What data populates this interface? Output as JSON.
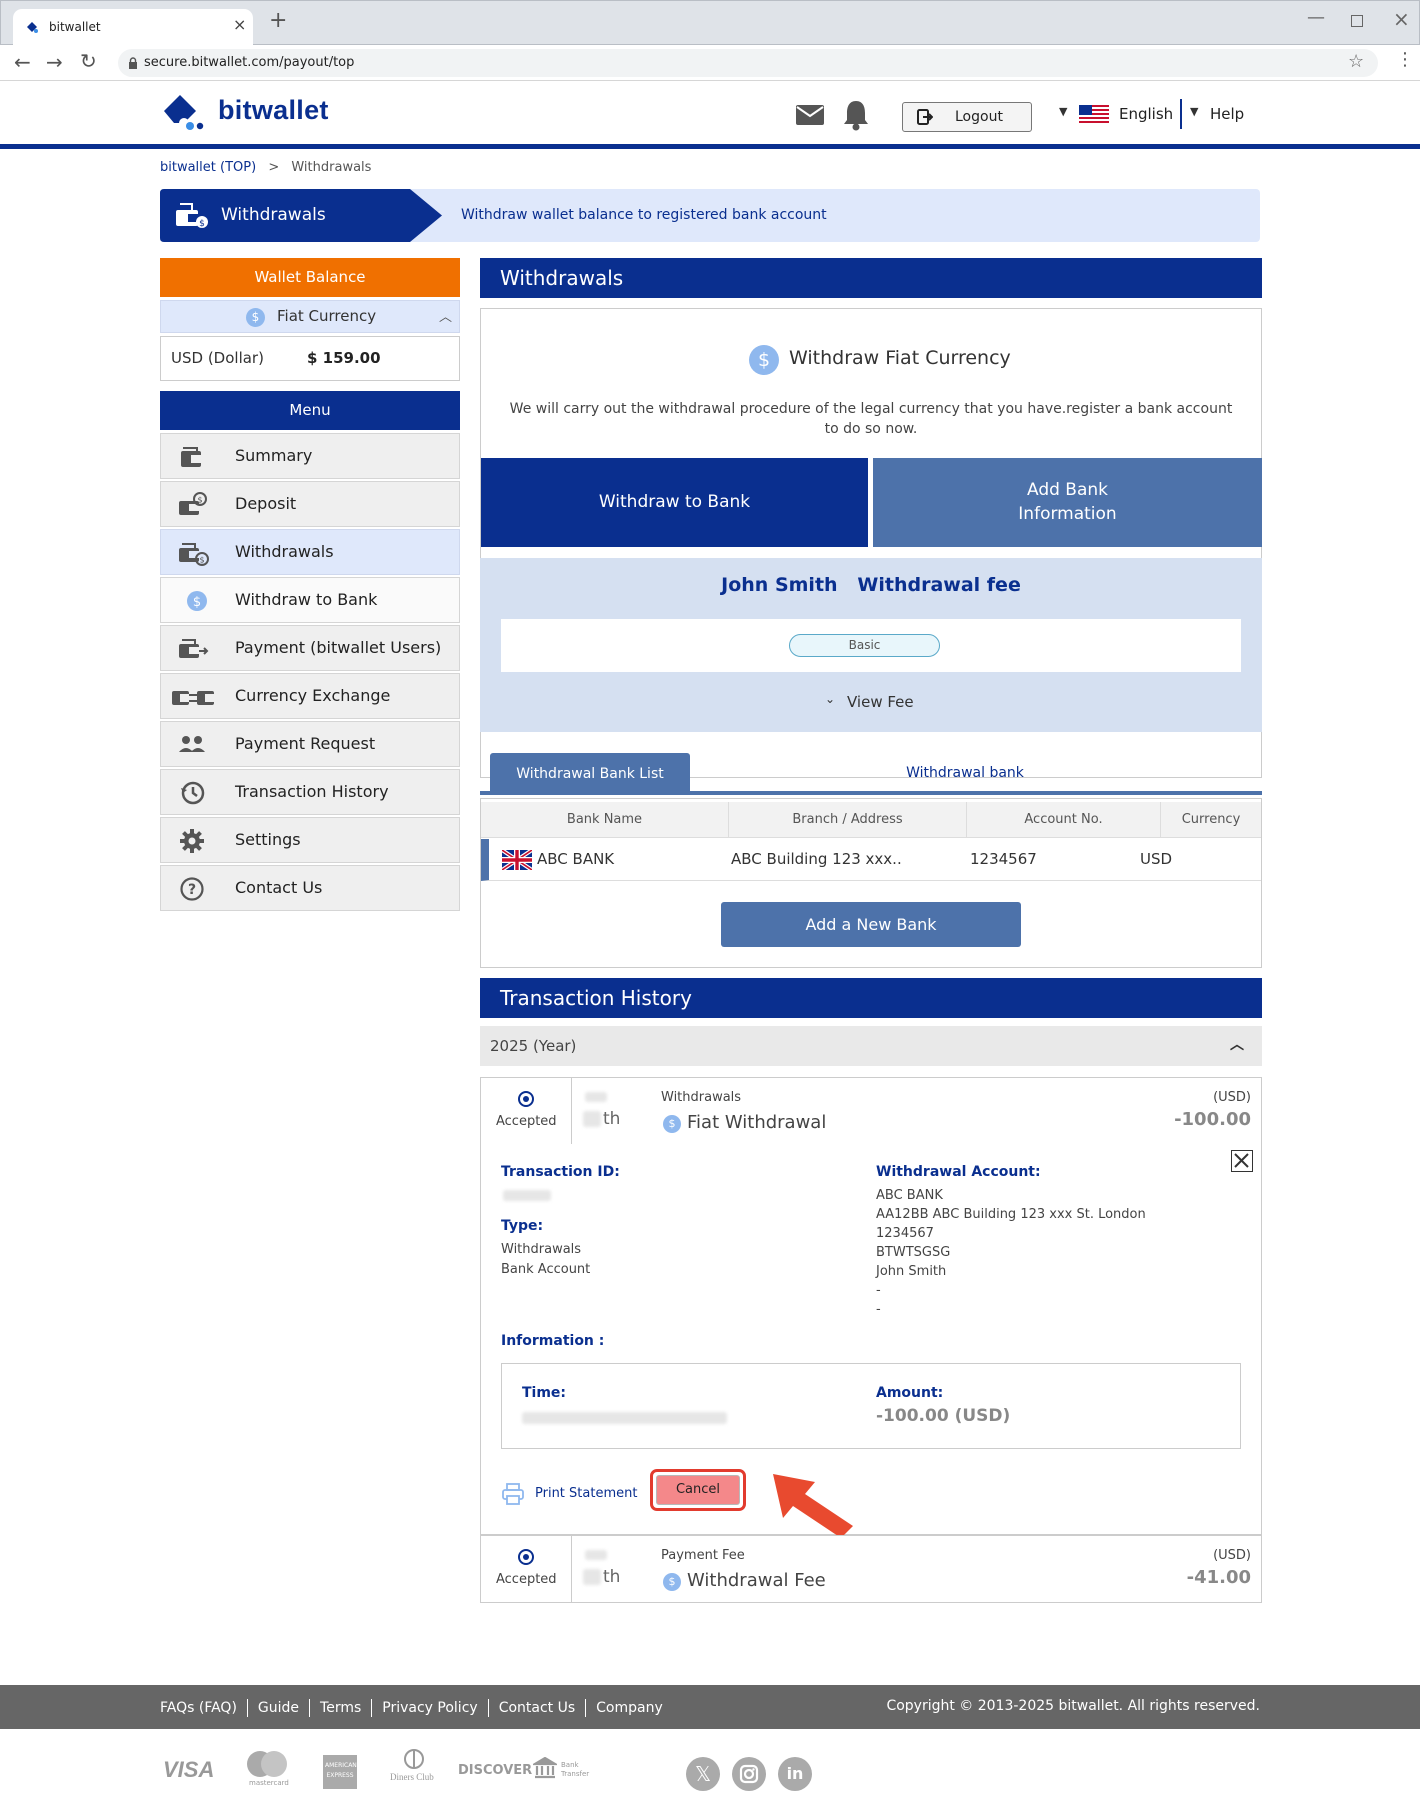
{
  "browser": {
    "tab_title": "bitwallet",
    "url": "secure.bitwallet.com/payout/top"
  },
  "header": {
    "logo_text": "bitwallet",
    "logout_label": "Logout",
    "language": "English",
    "help_label": "Help"
  },
  "breadcrumb": {
    "home": "bitwallet (TOP)",
    "separator": ">",
    "current": "Withdrawals"
  },
  "banner": {
    "title": "Withdrawals",
    "description": "Withdraw wallet balance to registered bank account"
  },
  "sidebar": {
    "wallet_balance_title": "Wallet Balance",
    "fiat_currency_label": "Fiat Currency",
    "balance_currency": "USD (Dollar)",
    "balance_amount": "$ 159.00",
    "menu_title": "Menu",
    "items": [
      {
        "label": "Summary",
        "icon": "wallet-icon"
      },
      {
        "label": "Deposit",
        "icon": "deposit-icon"
      },
      {
        "label": "Withdrawals",
        "icon": "withdraw-icon"
      },
      {
        "label": "Withdraw to Bank",
        "icon": "dollar-coin-icon"
      },
      {
        "label": "Payment (bitwallet Users)",
        "icon": "payment-icon"
      },
      {
        "label": "Currency Exchange",
        "icon": "exchange-icon"
      },
      {
        "label": "Payment Request",
        "icon": "users-icon"
      },
      {
        "label": "Transaction History",
        "icon": "history-icon"
      },
      {
        "label": "Settings",
        "icon": "gear-icon"
      },
      {
        "label": "Contact Us",
        "icon": "question-icon"
      }
    ]
  },
  "withdrawals": {
    "section_title": "Withdrawals",
    "fiat_title": "Withdraw Fiat Currency",
    "fiat_desc": "We will carry out the withdrawal procedure of the legal currency that you have.register a bank account to do so now.",
    "tab_withdraw": "Withdraw to Bank",
    "tab_add_bank_line1": "Add Bank",
    "tab_add_bank_line2": "Information",
    "fee_name": "John Smith",
    "fee_title": "Withdrawal fee",
    "fee_badge": "Basic",
    "view_fee": "View Fee"
  },
  "bank_list": {
    "tab_active": "Withdrawal Bank List",
    "tab_inactive": "Withdrawal bank",
    "columns": [
      "Bank Name",
      "Branch / Address",
      "Account No.",
      "Currency"
    ],
    "rows": [
      {
        "bank": "ABC BANK",
        "branch": "ABC Building 123 xxx..",
        "account": "1234567",
        "currency": "USD"
      }
    ],
    "add_button": "Add a New Bank"
  },
  "history": {
    "section_title": "Transaction History",
    "year_label": "2025 (Year)",
    "tx1": {
      "status": "Accepted",
      "day_suffix": "th",
      "category": "Withdrawals",
      "title": "Fiat Withdrawal",
      "currency": "(USD)",
      "amount": "-100.00"
    },
    "detail": {
      "txid_label": "Transaction ID:",
      "type_label": "Type:",
      "type_value1": "Withdrawals",
      "type_value2": "Bank Account",
      "account_label": "Withdrawal Account:",
      "account_lines": [
        "ABC BANK",
        "AA12BB ABC Building 123 xxx St. London",
        "1234567",
        "BTWTSGSG",
        "John Smith",
        "-",
        "-"
      ],
      "info_label": "Information :",
      "time_label": "Time:",
      "amount_label": "Amount:",
      "amount_value": "-100.00 (USD)",
      "print_label": "Print Statement",
      "cancel_label": "Cancel"
    },
    "tx2": {
      "status": "Accepted",
      "day_suffix": "th",
      "category": "Payment Fee",
      "title": "Withdrawal Fee",
      "currency": "(USD)",
      "amount": "-41.00"
    }
  },
  "footer": {
    "links": [
      "FAQs (FAQ)",
      "Guide",
      "Terms",
      "Privacy Policy",
      "Contact Us",
      "Company"
    ],
    "copyright": "Copyright © 2013-2025 bitwallet. All rights reserved.",
    "payment_logos": [
      "VISA",
      "mastercard",
      "AMERICAN EXPRESS",
      "Diners Club",
      "DISCOVER",
      "Bank Transfer"
    ],
    "social_icons": [
      "x-icon",
      "instagram-icon",
      "linkedin-icon"
    ]
  }
}
